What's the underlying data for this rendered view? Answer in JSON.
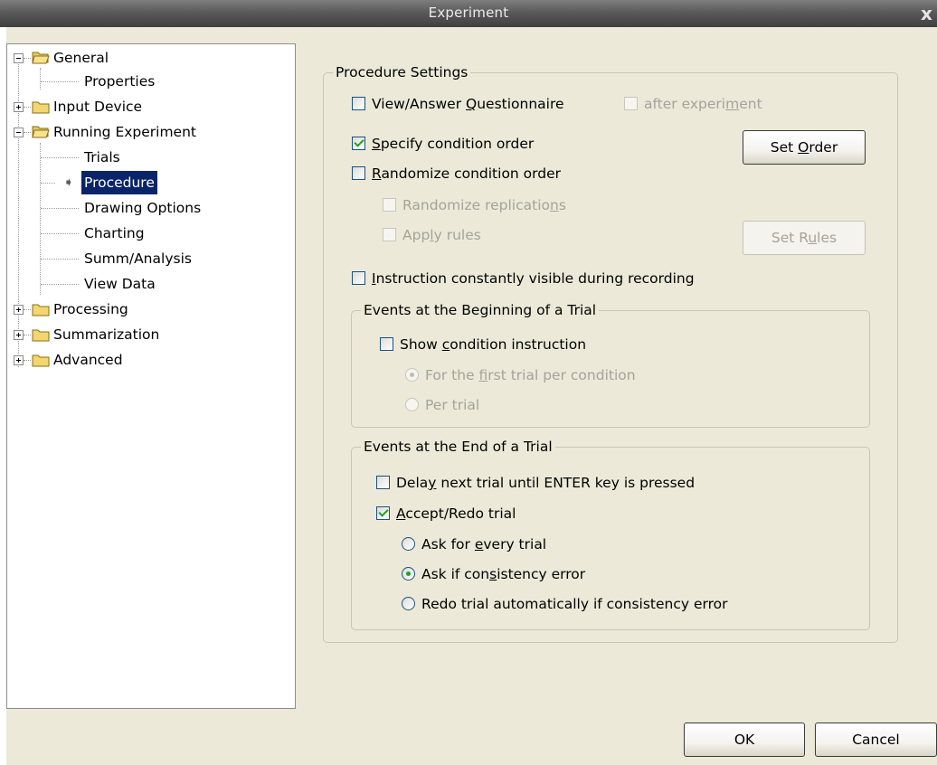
{
  "window": {
    "title": "Experiment"
  },
  "tree": {
    "general": "General",
    "properties": "Properties",
    "input_device": "Input Device",
    "running_experiment": "Running Experiment",
    "trials": "Trials",
    "procedure": "Procedure",
    "drawing_options": "Drawing Options",
    "charting": "Charting",
    "summ_analysis": "Summ/Analysis",
    "view_data": "View Data",
    "processing": "Processing",
    "summarization": "Summarization",
    "advanced": "Advanced"
  },
  "procedure_settings": {
    "title": "Procedure Settings",
    "view_answer_a": "View/Answer ",
    "view_answer_u": "Q",
    "view_answer_b": "uestionnaire",
    "after_a": "after experi",
    "after_u": "m",
    "after_b": "ent",
    "specify_u": "S",
    "specify_b": "pecify condition order",
    "set_order_a": "Set ",
    "set_order_u": "O",
    "set_order_b": "rder",
    "randomize_u": "R",
    "randomize_b": "andomize condition order",
    "rand_rep_a": "Randomize replicatio",
    "rand_rep_u": "n",
    "rand_rep_b": "s",
    "apply_a": "App",
    "apply_u": "l",
    "apply_b": "y rules",
    "set_rules_a": "Set R",
    "set_rules_u": "u",
    "set_rules_b": "les",
    "instruction_u": "I",
    "instruction_b": "nstruction constantly visible during recording"
  },
  "beginning": {
    "title": "Events at the Beginning of a Trial",
    "show_a": "Show ",
    "show_u": "c",
    "show_b": "ondition instruction",
    "first_a": "For the ",
    "first_u": "f",
    "first_b": "irst trial per condition",
    "per_trial": "Per trial"
  },
  "end": {
    "title": "Events at the End of a Trial",
    "delay_a": "Dela",
    "delay_u": "y",
    "delay_b": " next trial until ENTER key is pressed",
    "accept_u": "A",
    "accept_b": "ccept/Redo trial",
    "every_a": "Ask for ",
    "every_u": "e",
    "every_b": "very trial",
    "cons_a": "Ask if con",
    "cons_u": "s",
    "cons_b": "istency error",
    "redo": "Redo trial automatically if consistency error"
  },
  "buttons": {
    "ok": "OK",
    "cancel": "Cancel"
  },
  "colors": {
    "dialog_bg": "#ece9d8",
    "selection": "#0a246a",
    "check": "#21a121"
  }
}
